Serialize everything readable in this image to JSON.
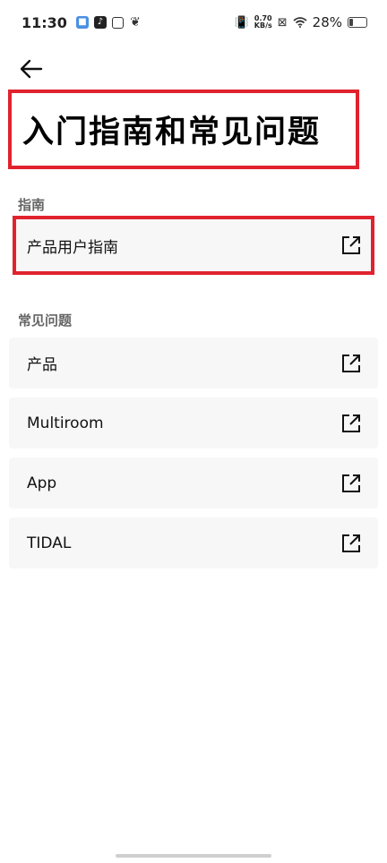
{
  "status_bar": {
    "time": "11:30",
    "net_speed_value": "0.70",
    "net_speed_unit": "KB/s",
    "battery_percent": "28%",
    "battery_level": 0.28
  },
  "header": {
    "title": "入门指南和常见问题"
  },
  "guide_section": {
    "label": "指南",
    "items": [
      {
        "label": "产品用户指南"
      }
    ]
  },
  "faq_section": {
    "label": "常见问题",
    "items": [
      {
        "label": "产品"
      },
      {
        "label": "Multiroom"
      },
      {
        "label": "App"
      },
      {
        "label": "TIDAL"
      }
    ]
  },
  "colors": {
    "highlight_border": "#e0232e",
    "row_background": "#f7f7f7"
  }
}
